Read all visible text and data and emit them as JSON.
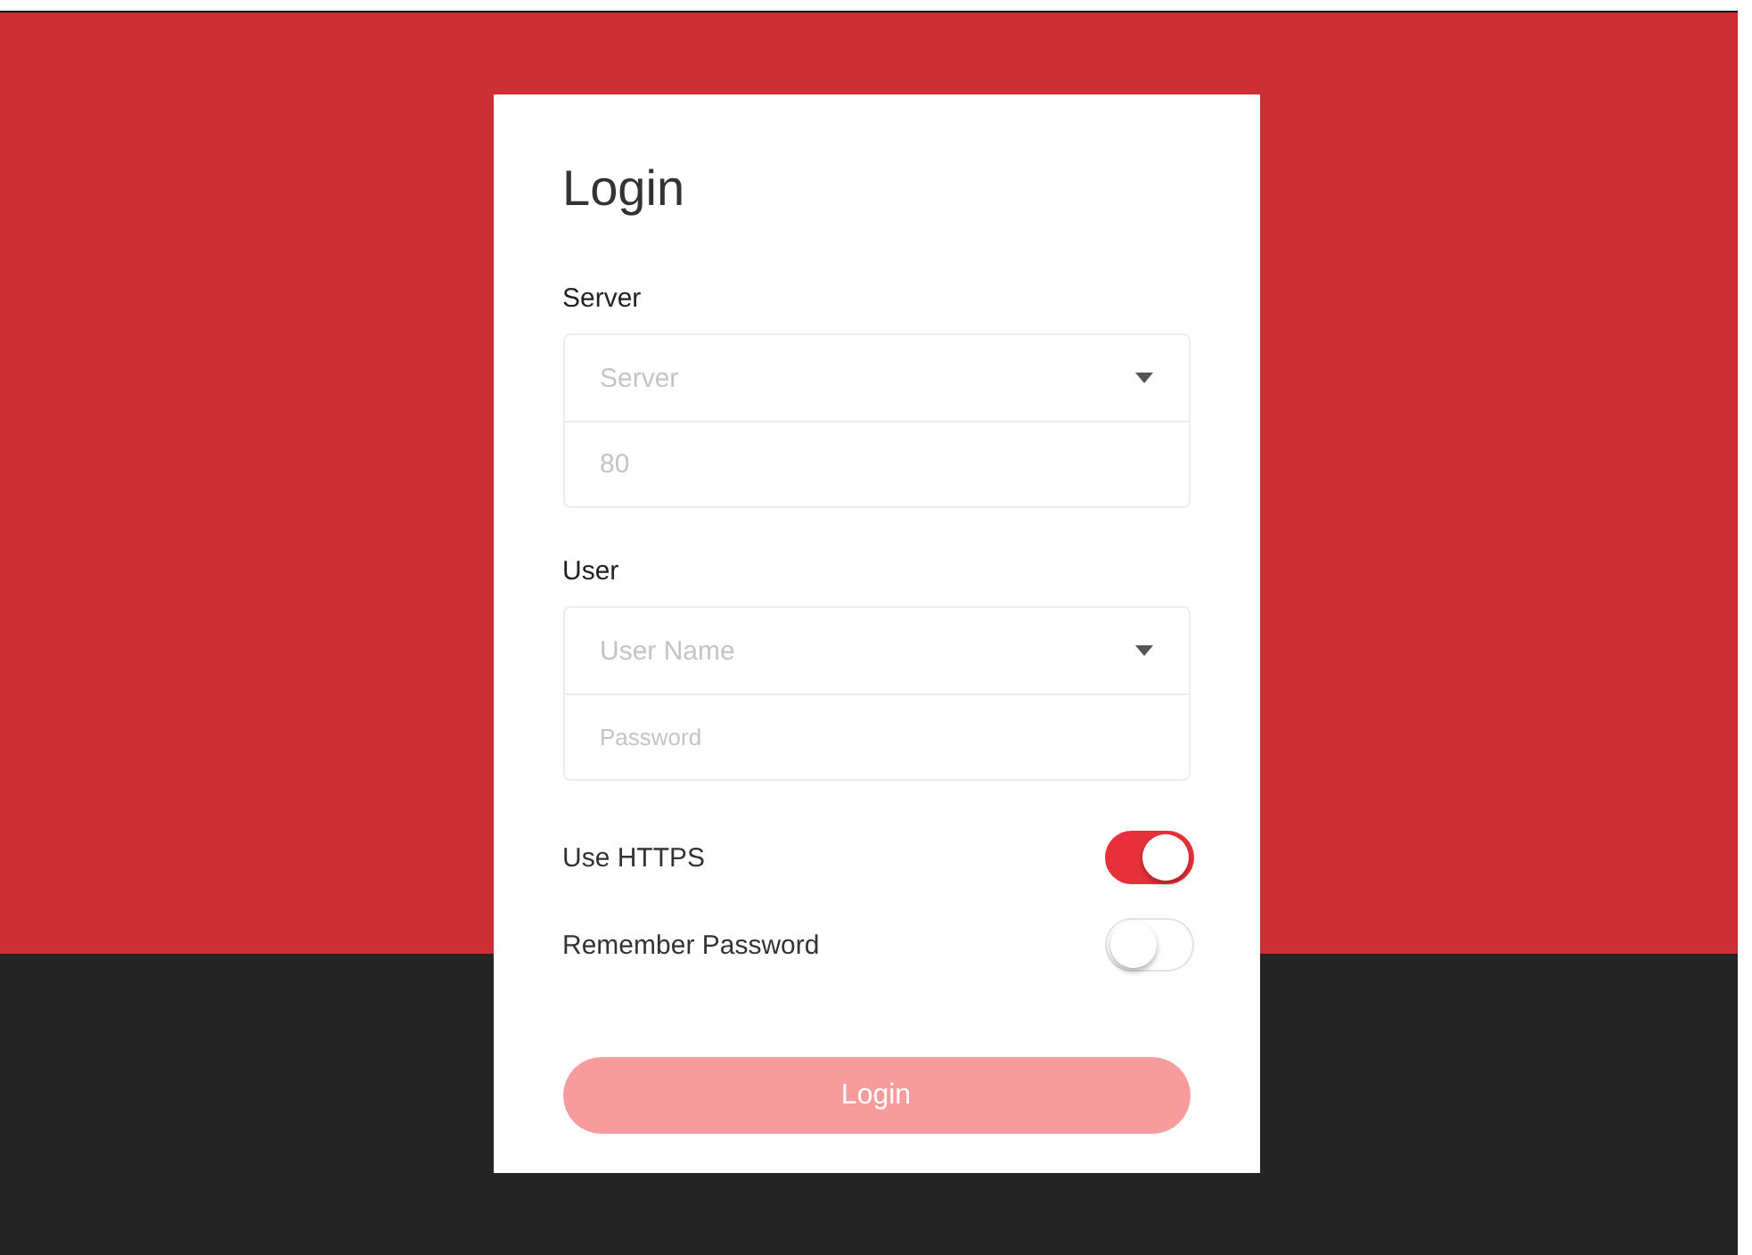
{
  "title": "Login",
  "groups": [
    {
      "label": "Server",
      "fields": [
        {
          "kind": "select",
          "placeholder": "Server"
        },
        {
          "kind": "text",
          "placeholder": "80"
        }
      ]
    },
    {
      "label": "User",
      "fields": [
        {
          "kind": "select",
          "placeholder": "User Name"
        },
        {
          "kind": "password",
          "placeholder": "Password"
        }
      ]
    }
  ],
  "switches": [
    {
      "label": "Use HTTPS",
      "on": true
    },
    {
      "label": "Remember Password",
      "on": false
    }
  ],
  "submit": {
    "label": "Login",
    "disabled": true
  }
}
